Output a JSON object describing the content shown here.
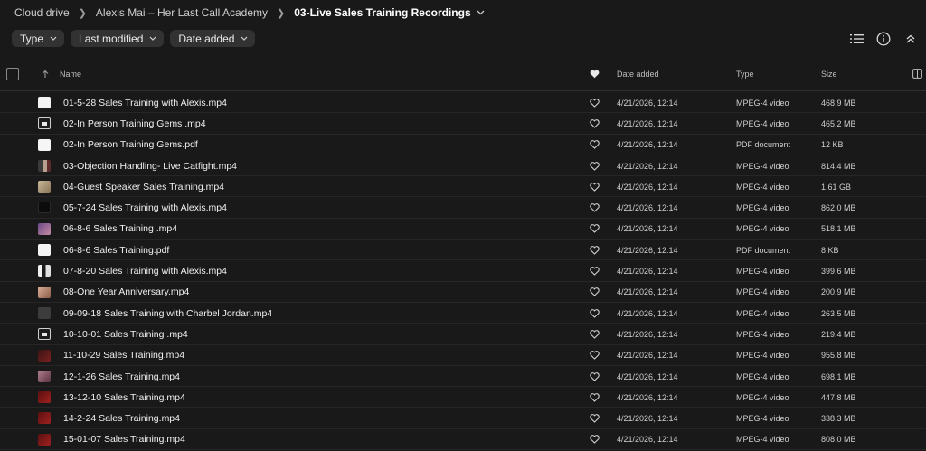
{
  "breadcrumb": {
    "items": [
      "Cloud drive",
      "Alexis Mai – Her Last Call Academy"
    ],
    "current": "03-Live Sales Training Recordings"
  },
  "filters": {
    "type": "Type",
    "modified": "Last modified",
    "added": "Date added"
  },
  "header": {
    "name": "Name",
    "date": "Date added",
    "type": "Type",
    "size": "Size"
  },
  "rows": [
    {
      "name": "01-5-28 Sales Training with Alexis.mp4",
      "date": "4/21/2026, 12:14",
      "type": "MPEG-4 video",
      "size": "468.9 MB",
      "thumb": "white"
    },
    {
      "name": "02-In Person Training Gems .mp4",
      "date": "4/21/2026, 12:14",
      "type": "MPEG-4 video",
      "size": "465.2 MB",
      "thumb": "screen"
    },
    {
      "name": "02-In Person Training Gems.pdf",
      "date": "4/21/2026, 12:14",
      "type": "PDF document",
      "size": "12 KB",
      "thumb": "pdf"
    },
    {
      "name": "03-Objection Handling- Live Catfight.mp4",
      "date": "4/21/2026, 12:14",
      "type": "MPEG-4 video",
      "size": "814.4 MB",
      "thumb": "person"
    },
    {
      "name": "04-Guest Speaker Sales Training.mp4",
      "date": "4/21/2026, 12:14",
      "type": "MPEG-4 video",
      "size": "1.61 GB",
      "thumb": "beige"
    },
    {
      "name": "05-7-24 Sales Training with Alexis.mp4",
      "date": "4/21/2026, 12:14",
      "type": "MPEG-4 video",
      "size": "862.0 MB",
      "thumb": "dark"
    },
    {
      "name": "06-8-6 Sales Training .mp4",
      "date": "4/21/2026, 12:14",
      "type": "MPEG-4 video",
      "size": "518.1 MB",
      "thumb": "purple"
    },
    {
      "name": "06-8-6 Sales Training.pdf",
      "date": "4/21/2026, 12:14",
      "type": "PDF document",
      "size": "8 KB",
      "thumb": "pdf"
    },
    {
      "name": "07-8-20 Sales Training with Alexis.mp4",
      "date": "4/21/2026, 12:14",
      "type": "MPEG-4 video",
      "size": "399.6 MB",
      "thumb": "bw"
    },
    {
      "name": "08-One Year Anniversary.mp4",
      "date": "4/21/2026, 12:14",
      "type": "MPEG-4 video",
      "size": "200.9 MB",
      "thumb": "skin"
    },
    {
      "name": "09-09-18 Sales Training with Charbel Jordan.mp4",
      "date": "4/21/2026, 12:14",
      "type": "MPEG-4 video",
      "size": "263.5 MB",
      "thumb": "grey"
    },
    {
      "name": "10-10-01 Sales Training .mp4",
      "date": "4/21/2026, 12:14",
      "type": "MPEG-4 video",
      "size": "219.4 MB",
      "thumb": "screen"
    },
    {
      "name": "11-10-29 Sales Training.mp4",
      "date": "4/21/2026, 12:14",
      "type": "MPEG-4 video",
      "size": "955.8 MB",
      "thumb": "darkred"
    },
    {
      "name": "12-1-26 Sales Training.mp4",
      "date": "4/21/2026, 12:14",
      "type": "MPEG-4 video",
      "size": "698.1 MB",
      "thumb": "mauve"
    },
    {
      "name": "13-12-10 Sales Training.mp4",
      "date": "4/21/2026, 12:14",
      "type": "MPEG-4 video",
      "size": "447.8 MB",
      "thumb": "red"
    },
    {
      "name": "14-2-24 Sales Training.mp4",
      "date": "4/21/2026, 12:14",
      "type": "MPEG-4 video",
      "size": "338.3 MB",
      "thumb": "red"
    },
    {
      "name": "15-01-07 Sales Training.mp4",
      "date": "4/21/2026, 12:14",
      "type": "MPEG-4 video",
      "size": "808.0 MB",
      "thumb": "red"
    }
  ],
  "icons": {
    "breadcrumb_separator": "chevron-right-icon",
    "dropdown": "chevron-down-icon",
    "sort": "arrow-up-icon",
    "favorite_header": "heart-filled-icon",
    "favorite_row": "heart-outline-icon",
    "list_view": "list-view-icon",
    "info": "info-icon",
    "collapse": "chevrons-up-icon",
    "column_settings": "columns-icon"
  },
  "colors": {
    "background": "#191919",
    "chip_background": "#323232",
    "text_primary": "#f0f0f0",
    "text_secondary": "#cfcfcf"
  }
}
